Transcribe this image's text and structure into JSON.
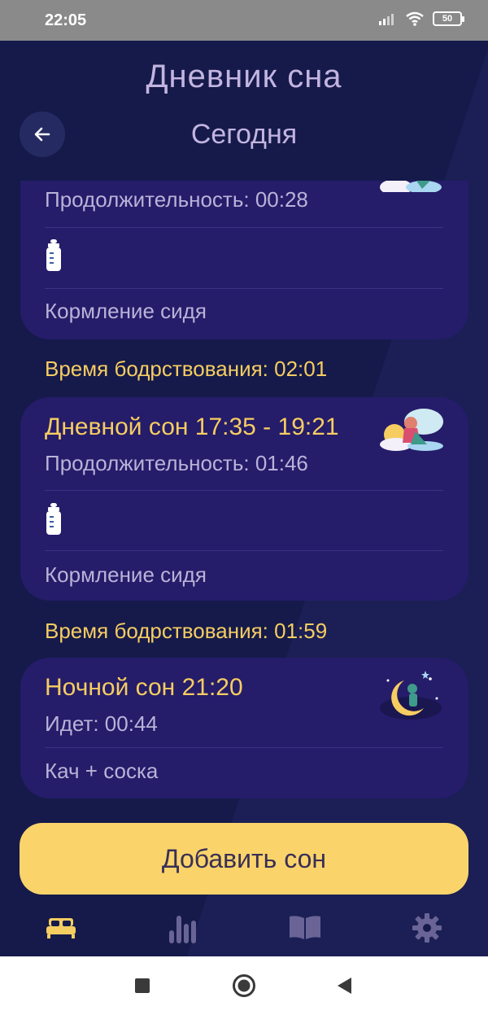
{
  "status_bar": {
    "time": "22:05",
    "battery": "50"
  },
  "header": {
    "title": "Дневник сна",
    "subtitle": "Сегодня"
  },
  "entries": [
    {
      "duration": "Продолжительность: 00:28",
      "note": "Кормление сидя"
    },
    {
      "title": "Дневной сон 17:35 - 19:21",
      "duration": "Продолжительность: 01:46",
      "note": "Кормление сидя"
    },
    {
      "title": "Ночной сон 21:20",
      "duration": "Идет: 00:44",
      "note": "Кач + соска"
    }
  ],
  "wake_labels": [
    "Время бодрствования: 02:01",
    "Время бодрствования: 01:59"
  ],
  "add_button": "Добавить сон",
  "tabs": [
    {
      "icon": "bed-icon",
      "active": true
    },
    {
      "icon": "stats-icon",
      "active": false
    },
    {
      "icon": "book-icon",
      "active": false
    },
    {
      "icon": "gear-icon",
      "active": false
    }
  ],
  "colors": {
    "background": "#151a4a",
    "card": "#251c6a",
    "accent": "#f6cd61",
    "button": "#fad46b",
    "text_muted": "#b9b3d8"
  }
}
